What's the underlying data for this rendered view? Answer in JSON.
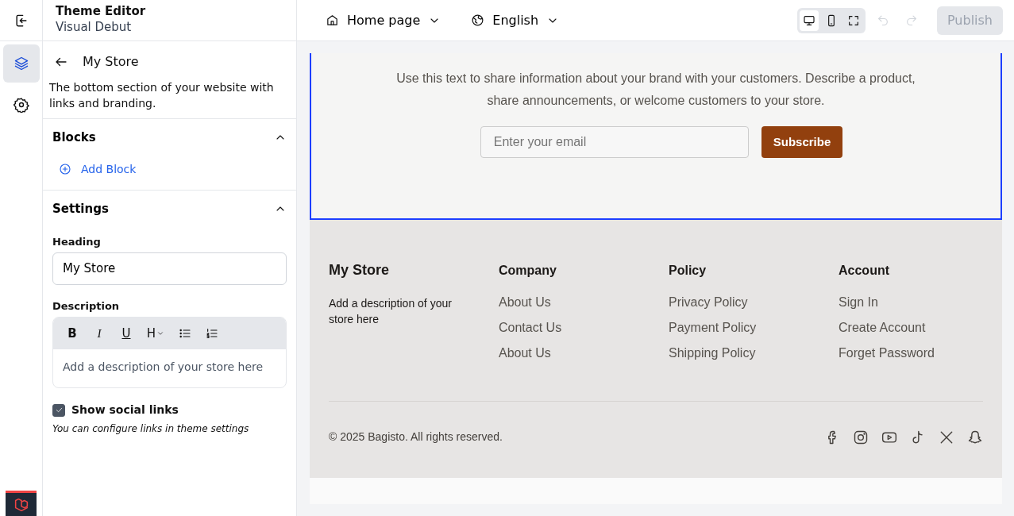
{
  "rail": {
    "items": [
      {
        "kind": "layers",
        "selected": true
      },
      {
        "kind": "settings",
        "selected": false
      }
    ]
  },
  "header": {
    "title": "Theme Editor",
    "subtitle": "Visual Debut",
    "page_select": "Home page",
    "locale_select": "English",
    "view_modes": [
      {
        "kind": "desktop",
        "selected": true
      },
      {
        "kind": "mobile",
        "selected": false
      },
      {
        "kind": "fullscreen",
        "selected": false
      }
    ],
    "undo": {
      "disabled": true
    },
    "redo": {
      "disabled": true
    },
    "publish": {
      "label": "Publish",
      "disabled": true
    }
  },
  "panel": {
    "title": "My Store",
    "description": "The bottom section of your website with links and branding.",
    "blocks": {
      "title": "Blocks",
      "expanded": true,
      "add_label": "Add Block"
    },
    "settings": {
      "title": "Settings",
      "expanded": true,
      "heading_label": "Heading",
      "heading_value": "My Store",
      "description_label": "Description",
      "toolbar": [
        {
          "kind": "bold",
          "label": "B"
        },
        {
          "kind": "italic",
          "label": "I"
        },
        {
          "kind": "underline",
          "label": "U"
        },
        {
          "kind": "heading",
          "label": "H"
        },
        {
          "kind": "bullets"
        },
        {
          "kind": "numbers"
        }
      ],
      "description_placeholder": "Add a description of your store here",
      "social": {
        "label": "Show social links",
        "checked": true,
        "hint": "You can configure links in theme settings"
      }
    }
  },
  "preview": {
    "newsletter": {
      "selected": true,
      "text": "Use this text to share information about your brand with your customers. Describe a product, share announcements, or welcome customers to your store.",
      "email_placeholder": "Enter your email",
      "button": "Subscribe"
    },
    "footer": {
      "brand": "My Store",
      "description": "Add a description of your store here",
      "columns": [
        {
          "title": "Company",
          "links": [
            "About Us",
            "Contact Us",
            "About Us"
          ]
        },
        {
          "title": "Policy",
          "links": [
            "Privacy Policy",
            "Payment Policy",
            "Shipping Policy"
          ]
        },
        {
          "title": "Account",
          "links": [
            "Sign In",
            "Create Account",
            "Forget Password"
          ]
        }
      ],
      "copyright": "© 2025 Bagisto. All rights reserved.",
      "social": [
        {
          "kind": "facebook"
        },
        {
          "kind": "instagram"
        },
        {
          "kind": "youtube"
        },
        {
          "kind": "tiktok"
        },
        {
          "kind": "x"
        },
        {
          "kind": "snapchat"
        }
      ]
    }
  }
}
